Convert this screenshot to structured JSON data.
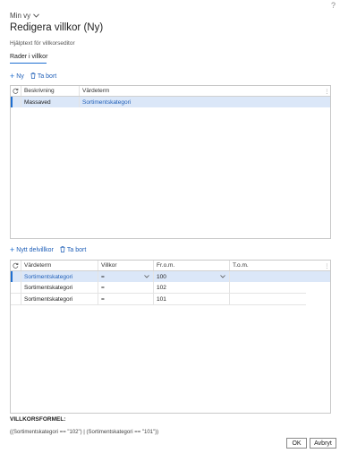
{
  "header": {
    "view_label": "Min vy",
    "title": "Redigera villkor (Ny)",
    "help_text": "Hjälptext för villkorseditor",
    "tab_label": "Rader i villkor"
  },
  "rows_toolbar": {
    "new_label": "Ny",
    "delete_label": "Ta bort"
  },
  "rows_grid": {
    "columns": [
      "Beskrivning",
      "Värdeterm"
    ],
    "rows": [
      {
        "description": "Massaved",
        "value_term": "Sortimentskategori"
      }
    ]
  },
  "sub_toolbar": {
    "new_label": "Nytt delvillkor",
    "delete_label": "Ta bort"
  },
  "sub_grid": {
    "columns": [
      "Värdeterm",
      "Villkor",
      "Fr.o.m.",
      "T.o.m."
    ],
    "rows": [
      {
        "value_term": "Sortimentskategori",
        "condition": "=",
        "from": "100",
        "to": ""
      },
      {
        "value_term": "Sortimentskategori",
        "condition": "=",
        "from": "102",
        "to": ""
      },
      {
        "value_term": "Sortimentskategori",
        "condition": "=",
        "from": "101",
        "to": ""
      }
    ]
  },
  "formula": {
    "label": "VILLKORSFORMEL:",
    "text": "((Sortimentskategori == \"102\") | (Sortimentskategori == \"101\"))"
  },
  "buttons": {
    "ok": "OK",
    "cancel": "Avbryt"
  },
  "icons": {
    "help": "question-icon",
    "view_chevron": "chevron-down-icon",
    "add": "plus-icon",
    "delete": "trash-icon",
    "refresh": "refresh-icon",
    "more": "more-vertical-icon"
  },
  "colors": {
    "accent": "#1f6fd1",
    "selected_row": "#dbe7f8",
    "link": "#1f5fb8"
  }
}
